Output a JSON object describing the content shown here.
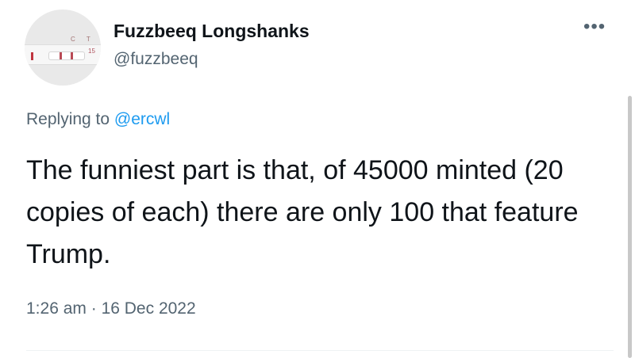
{
  "author": {
    "display_name": "Fuzzbeeq Longshanks",
    "handle": "@fuzzbeeq",
    "avatar_text": {
      "top": "C T",
      "side": "15"
    }
  },
  "more_options": "•••",
  "reply": {
    "prefix": "Replying to",
    "mention": "@ercwl"
  },
  "tweet": {
    "text": "The funniest part is that, of 45000 minted (20 copies of each) there are only 100 that feature Trump."
  },
  "meta": {
    "time": "1:26 am",
    "separator": "·",
    "date": "16 Dec 2022"
  },
  "colors": {
    "text": "#0f1419",
    "secondary": "#536471",
    "link": "#1d9bf0"
  }
}
